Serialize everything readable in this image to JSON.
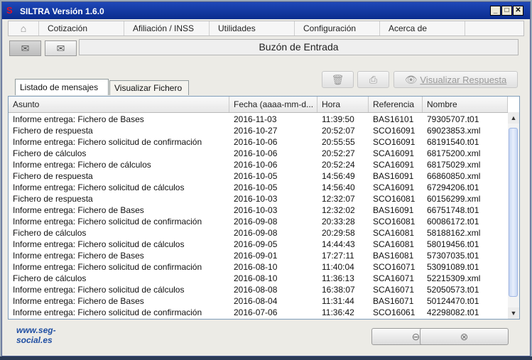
{
  "window": {
    "title": "SILTRA Versión 1.6.0",
    "logo_glyph": "S"
  },
  "menu": {
    "items": [
      "Cotización",
      "Afiliación / INSS",
      "Utilidades",
      "Configuración",
      "Acerca de"
    ]
  },
  "panel": {
    "title": "Buzón de Entrada"
  },
  "tabs": [
    "Listado de mensajes",
    "Visualizar Fichero"
  ],
  "toolbar": {
    "visualizar_label": "Visualizar Respuesta"
  },
  "table": {
    "headers": [
      "Asunto",
      "Fecha (aaaa-mm-d...",
      "Hora",
      "Referencia",
      "Nombre"
    ],
    "rows": [
      [
        "Informe entrega: Fichero de Bases",
        "2016-11-03",
        "11:39:50",
        "BAS16101",
        "79305707.t01"
      ],
      [
        "Fichero de respuesta",
        "2016-10-27",
        "20:52:07",
        "SCO16091",
        "69023853.xml"
      ],
      [
        "Informe entrega: Fichero solicitud de confirmación",
        "2016-10-06",
        "20:55:55",
        "SCO16091",
        "68191540.t01"
      ],
      [
        "Fichero de cálculos",
        "2016-10-06",
        "20:52:27",
        "SCA16091",
        "68175200.xml"
      ],
      [
        "Informe entrega: Fichero de cálculos",
        "2016-10-06",
        "20:52:24",
        "SCA16091",
        "68175029.xml"
      ],
      [
        "Fichero de respuesta",
        "2016-10-05",
        "14:56:49",
        "BAS16091",
        "66860850.xml"
      ],
      [
        "Informe entrega: Fichero solicitud de cálculos",
        "2016-10-05",
        "14:56:40",
        "SCA16091",
        "67294206.t01"
      ],
      [
        "Fichero de respuesta",
        "2016-10-03",
        "12:32:07",
        "SCO16081",
        "60156299.xml"
      ],
      [
        "Informe entrega: Fichero de Bases",
        "2016-10-03",
        "12:32:02",
        "BAS16091",
        "66751748.t01"
      ],
      [
        "Informe entrega: Fichero solicitud de confirmación",
        "2016-09-08",
        "20:33:28",
        "SCO16081",
        "60086172.t01"
      ],
      [
        "Fichero de cálculos",
        "2016-09-08",
        "20:29:58",
        "SCA16081",
        "58188162.xml"
      ],
      [
        "Informe entrega: Fichero solicitud de cálculos",
        "2016-09-05",
        "14:44:43",
        "SCA16081",
        "58019456.t01"
      ],
      [
        "Informe entrega: Fichero de Bases",
        "2016-09-01",
        "17:27:11",
        "BAS16081",
        "57307035.t01"
      ],
      [
        "Informe entrega: Fichero solicitud de confirmación",
        "2016-08-10",
        "11:40:04",
        "SCO16071",
        "53091089.t01"
      ],
      [
        "Fichero de cálculos",
        "2016-08-10",
        "11:36:13",
        "SCA16071",
        "52215309.xml"
      ],
      [
        "Informe entrega: Fichero solicitud de cálculos",
        "2016-08-08",
        "16:38:07",
        "SCA16071",
        "52050573.t01"
      ],
      [
        "Informe entrega: Fichero de Bases",
        "2016-08-04",
        "11:31:44",
        "BAS16071",
        "50124470.t01"
      ],
      [
        "Informe entrega: Fichero solicitud de confirmación",
        "2016-07-06",
        "11:36:42",
        "SCO16061",
        "42298082.t01"
      ]
    ]
  },
  "footer": {
    "logo_text": "www.seg-social.es"
  }
}
